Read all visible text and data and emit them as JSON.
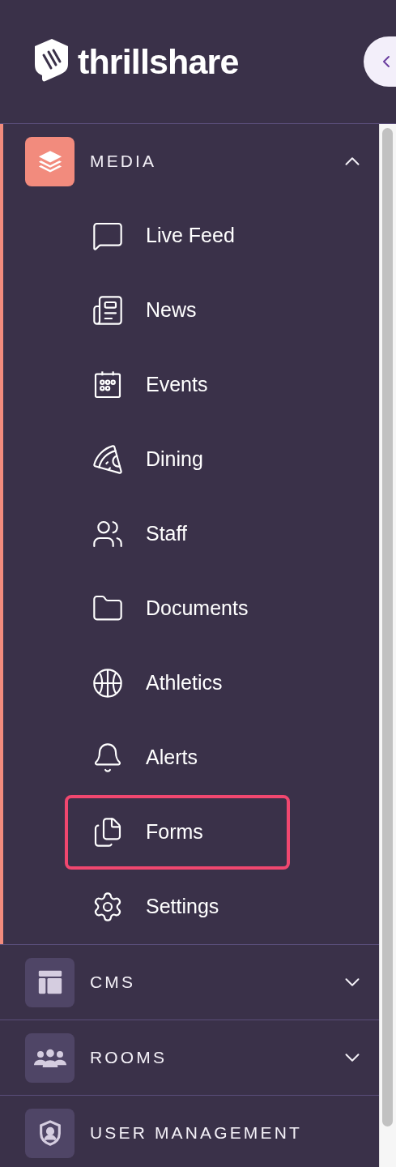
{
  "logo": {
    "text": "thrillshare"
  },
  "sections": [
    {
      "label": "MEDIA",
      "active": true,
      "expanded": true,
      "children": [
        {
          "label": "Live Feed",
          "highlighted": false
        },
        {
          "label": "News",
          "highlighted": false
        },
        {
          "label": "Events",
          "highlighted": false
        },
        {
          "label": "Dining",
          "highlighted": false
        },
        {
          "label": "Staff",
          "highlighted": false
        },
        {
          "label": "Documents",
          "highlighted": false
        },
        {
          "label": "Athletics",
          "highlighted": false
        },
        {
          "label": "Alerts",
          "highlighted": false
        },
        {
          "label": "Forms",
          "highlighted": true
        },
        {
          "label": "Settings",
          "highlighted": false
        }
      ]
    },
    {
      "label": "CMS",
      "active": false,
      "expanded": false
    },
    {
      "label": "ROOMS",
      "active": false,
      "expanded": false
    },
    {
      "label": "USER MANAGEMENT",
      "active": false
    }
  ]
}
